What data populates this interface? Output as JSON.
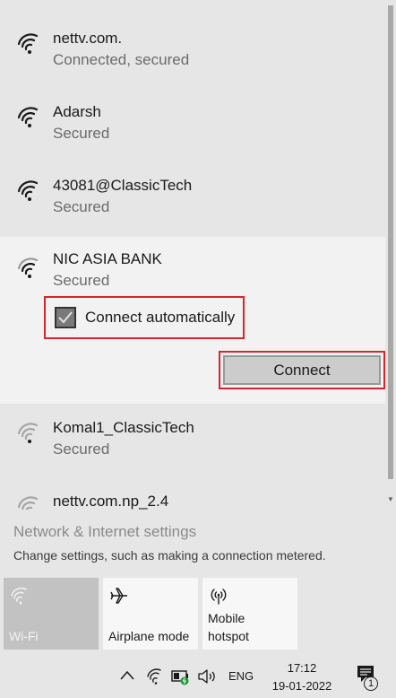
{
  "networks": [
    {
      "name": "nettv.com.",
      "status": "Connected, secured"
    },
    {
      "name": "Adarsh",
      "status": "Secured"
    },
    {
      "name": "43081@ClassicTech",
      "status": "Secured"
    },
    {
      "name": "NIC ASIA BANK",
      "status": "Secured"
    },
    {
      "name": "Komal1_ClassicTech",
      "status": "Secured"
    },
    {
      "name": "nettv.com.np_2.4",
      "status": ""
    }
  ],
  "selected_network": {
    "connect_automatically_label": "Connect automatically",
    "connect_automatically_checked": true,
    "connect_button_label": "Connect"
  },
  "settings": {
    "title": "Network & Internet settings",
    "description": "Change settings, such as making a connection metered."
  },
  "quick_actions": [
    {
      "label": "Wi-Fi",
      "icon": "wifi-icon",
      "active": true
    },
    {
      "label": "Airplane mode",
      "icon": "airplane-icon",
      "active": false
    },
    {
      "label_line1": "Mobile",
      "label_line2": "hotspot",
      "icon": "hotspot-icon",
      "active": false
    }
  ],
  "taskbar": {
    "language": "ENG",
    "time": "17:12",
    "date": "19-01-2022",
    "notification_count": "1"
  },
  "colors": {
    "highlight_border": "#d6262d",
    "panel_bg": "#e6e6e6",
    "selected_bg": "#f2f2f2"
  }
}
